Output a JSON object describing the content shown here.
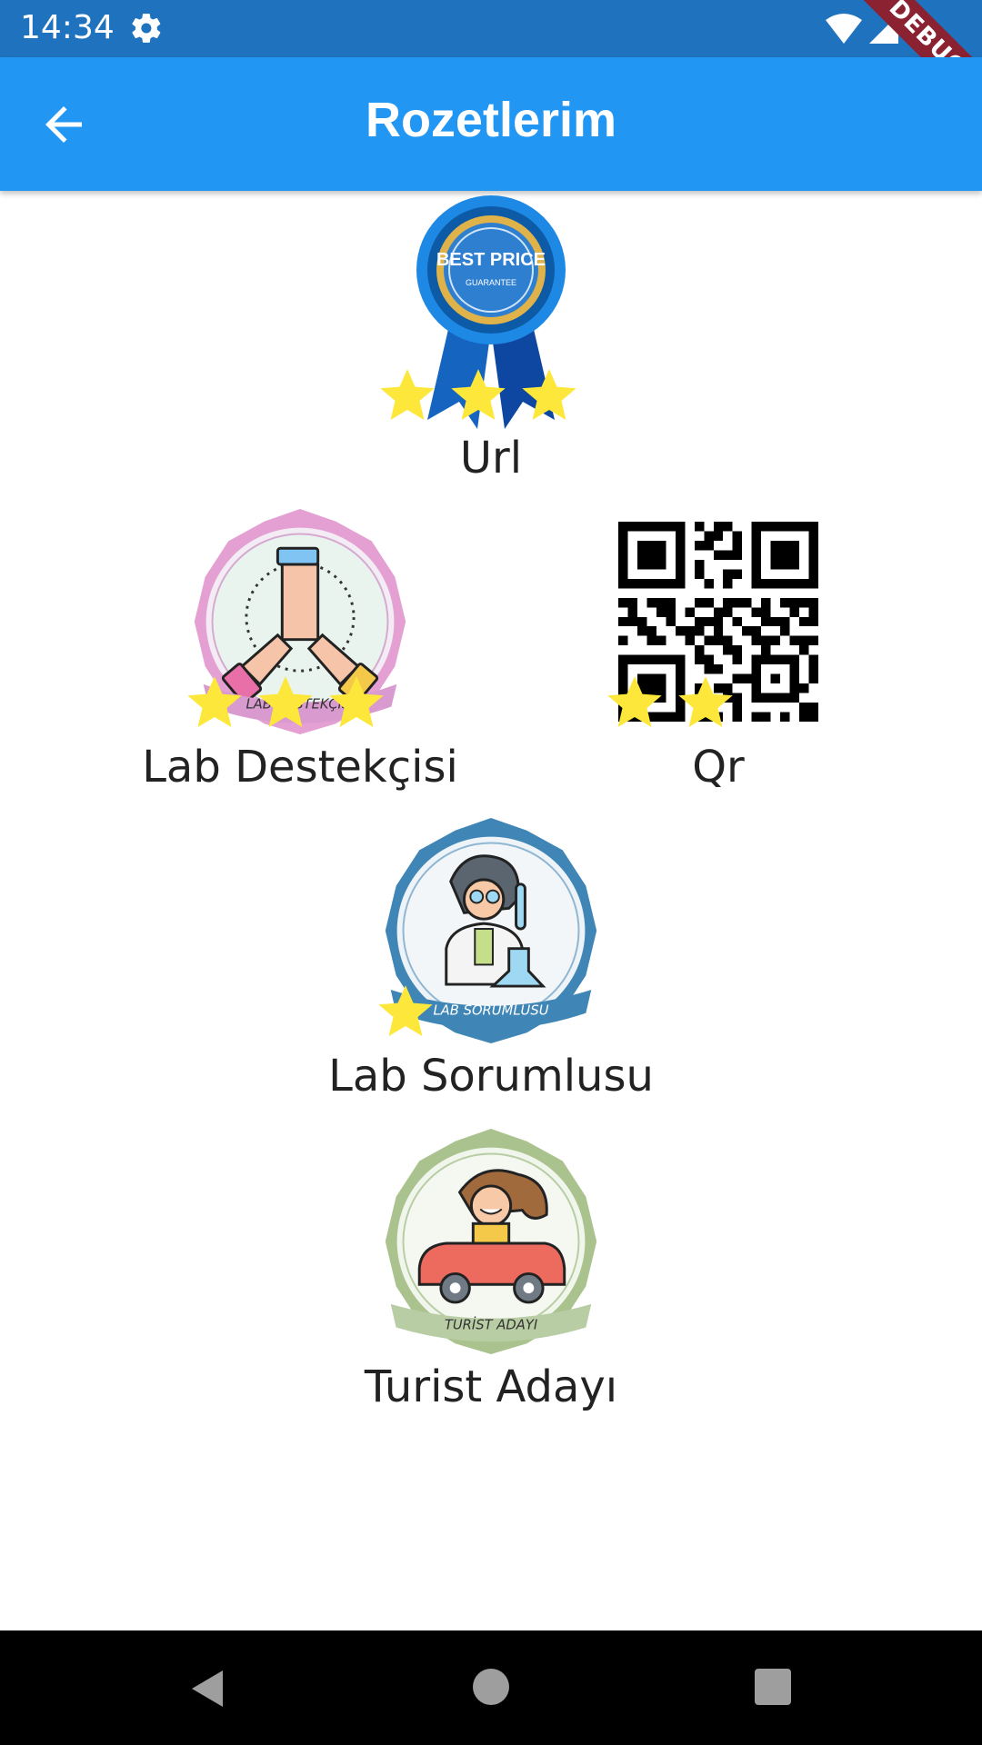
{
  "status": {
    "time": "14:34",
    "debug_label": "DEBUG"
  },
  "app_bar": {
    "title": "Rozetlerim"
  },
  "badges": [
    {
      "label": "Url",
      "stars": 3,
      "ribbon_text": "BEST PRICE",
      "ribbon_sub": "GUARANTEE"
    },
    {
      "label": "Lab Destekçisi",
      "stars": 3,
      "ribbon_text": "LAB DESTEKÇİSİ"
    },
    {
      "label": "Qr",
      "stars": 2
    },
    {
      "label": "Lab Sorumlusu",
      "stars": 1,
      "ribbon_text": "LAB SORUMLUSU"
    },
    {
      "label": "Turist Adayı",
      "stars": 0,
      "ribbon_text": "TURİST ADAYI"
    }
  ],
  "colors": {
    "app_bar": "#2196f3",
    "status_bar": "#1f73be",
    "star": "#fde73a"
  }
}
